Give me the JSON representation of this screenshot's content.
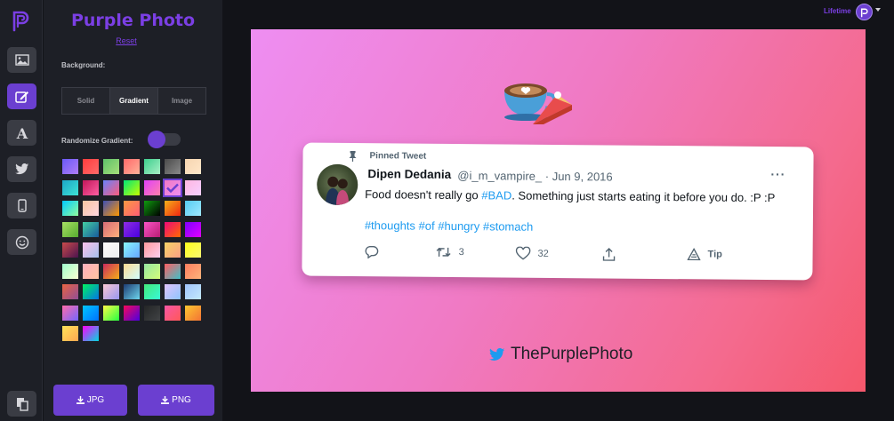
{
  "app": {
    "title": "Purple Photo",
    "reset_label": "Reset"
  },
  "panel": {
    "background_label": "Background:",
    "background_options": [
      "Solid",
      "Gradient",
      "Image"
    ],
    "selected_background": "Gradient",
    "randomize_label": "Randomize Gradient:",
    "randomize_enabled": true
  },
  "gradients": [
    [
      "#6a5af9",
      "#b07df4"
    ],
    [
      "#ff3d3d",
      "#ff6a6a"
    ],
    [
      "#5fc16a",
      "#a6e07a"
    ],
    [
      "#ff6a6a",
      "#ffb199"
    ],
    [
      "#3ecf8e",
      "#a8f0c6"
    ],
    [
      "#4b4b4b",
      "#8a8a8a"
    ],
    [
      "#f6d5b0",
      "#ffe7c9"
    ],
    [
      "#1ca7c8",
      "#3fe3d5"
    ],
    [
      "#c2185b",
      "#ff5fa2"
    ],
    [
      "#6a82fb",
      "#fc5c7d"
    ],
    [
      "#00e676",
      "#c6ff00"
    ],
    [
      "#e040fb",
      "#ff80ab"
    ],
    [
      "#f07ac4",
      "#ee8ef2"
    ],
    [
      "#ffb6e1",
      "#f6d0ff"
    ],
    [
      "#00c9ff",
      "#92fe9d"
    ],
    [
      "#f8c5a2",
      "#ffd6e0"
    ],
    [
      "#3f51b5",
      "#ff9800"
    ],
    [
      "#fc9842",
      "#fe5f75"
    ],
    [
      "#0f9b0f",
      "#000000"
    ],
    [
      "#f5af19",
      "#f12711"
    ],
    [
      "#56ccf2",
      "#a0e9ff"
    ],
    [
      "#a8e063",
      "#56ab2f"
    ],
    [
      "#43cea2",
      "#185a9d"
    ],
    [
      "#d76d77",
      "#ffaf7b"
    ],
    [
      "#8e2de2",
      "#4a00e0"
    ],
    [
      "#f953c6",
      "#b91d73"
    ],
    [
      "#ee0979",
      "#ff6a00"
    ],
    [
      "#7f00ff",
      "#e100ff"
    ],
    [
      "#c94b4b",
      "#4b134f"
    ],
    [
      "#fbc2eb",
      "#a6c1ee"
    ],
    [
      "#fdfbfb",
      "#ebedee"
    ],
    [
      "#89f7fe",
      "#66a6ff"
    ],
    [
      "#ff9a9e",
      "#fecfef"
    ],
    [
      "#f6d365",
      "#fda085"
    ],
    [
      "#ffff1c",
      "#f9f871"
    ],
    [
      "#a1ffce",
      "#faffd1"
    ],
    [
      "#ffafbd",
      "#ffc3a0"
    ],
    [
      "#cc2b5e",
      "#f5af19"
    ],
    [
      "#fddb92",
      "#d1fdff"
    ],
    [
      "#96e6a1",
      "#d4fc79"
    ],
    [
      "#ff5e62",
      "#3fc1c9"
    ],
    [
      "#ff7e5f",
      "#feb47b"
    ],
    [
      "#e96443",
      "#904e95"
    ],
    [
      "#00f260",
      "#0575e6"
    ],
    [
      "#fbc7d4",
      "#9796f0"
    ],
    [
      "#1e3c72",
      "#6dd5ed"
    ],
    [
      "#43e97b",
      "#38f9d7"
    ],
    [
      "#e0c3fc",
      "#8ec5fc"
    ],
    [
      "#a1c4fd",
      "#c2e9fb"
    ],
    [
      "#ff6cab",
      "#7366ff"
    ],
    [
      "#00c6ff",
      "#0072ff"
    ],
    [
      "#fdfc47",
      "#24fe41"
    ],
    [
      "#f80759",
      "#4a00e0"
    ],
    [
      "#232526",
      "#414345"
    ],
    [
      "#f857a6",
      "#ff5858"
    ],
    [
      "#fdc830",
      "#f37335"
    ],
    [
      "#ffe259",
      "#ffa751"
    ],
    [
      "#fc00ff",
      "#00dbde"
    ]
  ],
  "selected_gradient_index": 12,
  "downloads": {
    "jpg_label": "JPG",
    "png_label": "PNG"
  },
  "account": {
    "plan_label": "Lifetime"
  },
  "tweet": {
    "pinned_label": "Pinned Tweet",
    "name": "Dipen Dedania",
    "meta": "@i_m_vampire_ · Jun 9, 2016",
    "more": "···",
    "text_before": "Food doesn't really go ",
    "text_link": "#BAD",
    "text_after": ". Something just starts eating it before you do. :P :P",
    "hashtags": [
      "#thoughts",
      "#of",
      "#hungry",
      "#stomach"
    ],
    "retweets": "3",
    "likes": "32",
    "tip_label": "Tip"
  },
  "brand_handle": "ThePurplePhoto",
  "colors": {
    "accent": "#6b3fd0",
    "title": "#7b3fe4",
    "twitter_blue": "#1d9bf0"
  }
}
